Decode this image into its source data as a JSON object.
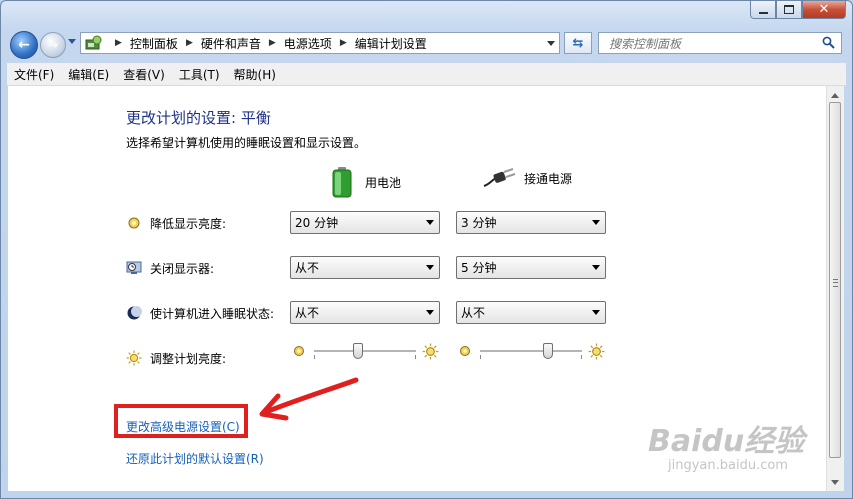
{
  "window": {
    "address": [
      "控制面板",
      "硬件和声音",
      "电源选项",
      "编辑计划设置"
    ],
    "search_placeholder": "搜索控制面板"
  },
  "menu": [
    "文件(F)",
    "编辑(E)",
    "查看(V)",
    "工具(T)",
    "帮助(H)"
  ],
  "page": {
    "title": "更改计划的设置: 平衡",
    "subtitle": "选择希望计算机使用的睡眠设置和显示设置。",
    "columns": {
      "battery": "用电池",
      "plugged": "接通电源"
    },
    "rows": [
      {
        "label": "降低显示亮度:",
        "battery": "20 分钟",
        "plugged": "3 分钟"
      },
      {
        "label": "关闭显示器:",
        "battery": "从不",
        "plugged": "5 分钟"
      },
      {
        "label": "使计算机进入睡眠状态:",
        "battery": "从不",
        "plugged": "从不"
      }
    ],
    "brightness_label": "调整计划亮度:",
    "brightness": {
      "battery": 0.43,
      "plugged": 0.67
    },
    "links": {
      "advanced": "更改高级电源设置(C)",
      "restore": "还原此计划的默认设置(R)"
    }
  },
  "watermark": {
    "brand": "Baidu经验",
    "url": "jingyan.baidu.com"
  },
  "colors": {
    "title": "#1e3287",
    "link": "#1560bd",
    "annotation": "#e01f1f"
  }
}
